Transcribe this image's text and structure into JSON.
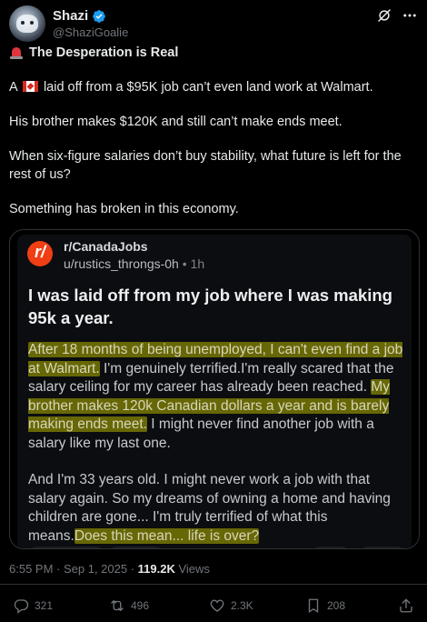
{
  "author": {
    "name": "Shazi",
    "handle": "@ShaziGoalie"
  },
  "tweet": {
    "headline": "The Desperation is Real",
    "line1_prefix": "A",
    "line1_suffix": "laid off from a $95K job can’t even land work at Walmart.",
    "line2": "His brother makes $120K and still can’t make ends meet.",
    "line3": "When six-figure salaries don’t buy stability, what future is left for the rest of us?",
    "line4": "Something has broken in this economy."
  },
  "reddit": {
    "logo_letter": "r/",
    "subreddit": "r/CanadaJobs",
    "user": "u/rustics_throngs-0h",
    "separator": "•",
    "age": "1h",
    "title": "I was laid off from my job where I was making 95k a year.",
    "p1_hl1": "After 18 months of being unemployed, I can't even find a job at Walmart.",
    "p1_t1": " I'm genuinely terrified.I'm really scared that the salary ceiling for my career has already been reached. ",
    "p1_hl2": "My brother makes 120k Canadian dollars a year and is barely making ends meet.",
    "p1_t2": " I might never find another job with a salary like my last one.",
    "p2_t1": "And I'm 33 years old. I might never work a job with that salary again. So my dreams of owning a home and having children are gone... I'm truly terrified of what this means.",
    "p2_hl": "Does this mean... life is over?"
  },
  "footer": {
    "timestamp": "6:55 PM · Sep 1, 2025 · ",
    "views_count": "119.2K",
    "views_label": " Views"
  },
  "actions": {
    "replies": "321",
    "reposts": "496",
    "likes": "2.3K",
    "bookmarks": "208"
  },
  "colors": {
    "background": "#000000",
    "verified_blue": "#1d9bf0",
    "reddit_orange": "#f03e15",
    "highlight": "#8a8a00"
  }
}
